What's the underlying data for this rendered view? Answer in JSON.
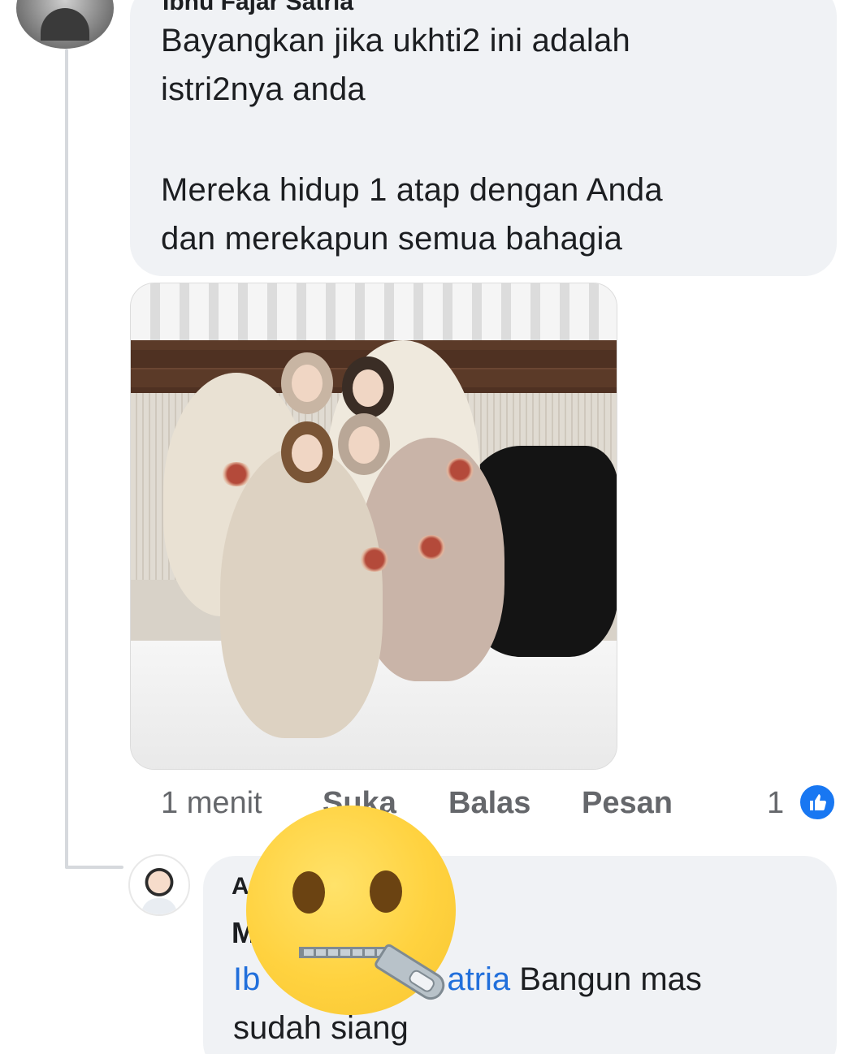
{
  "comment": {
    "author_partial": "Ibnu Fajar Satria",
    "text_lines": [
      "Bayangkan jika ukhti2 ini adalah",
      "istri2nya anda",
      "Mereka hidup 1 atap dengan Anda",
      "dan merekapun semua bahagia"
    ],
    "photo_icon": "attached-photo",
    "time": "1 menit",
    "like_label": "Suka",
    "reply_label": "Balas",
    "message_label": "Pesan",
    "reaction_count": "1",
    "reaction_icon": "thumbs-up-icon"
  },
  "reply": {
    "author_prefix_visible": "A",
    "author_initial_visible": "M",
    "mention_visible_start": "Ib",
    "mention_visible_end": "atria",
    "text_after_mention": "Bangun mas",
    "text_line2": "sudah siang"
  },
  "overlay": {
    "icon": "zipper-mouth-face-emoji"
  },
  "colors": {
    "bubble": "#f0f2f5",
    "mention": "#216fdb",
    "meta_text": "#65676b",
    "like_blue": "#1877f2"
  }
}
